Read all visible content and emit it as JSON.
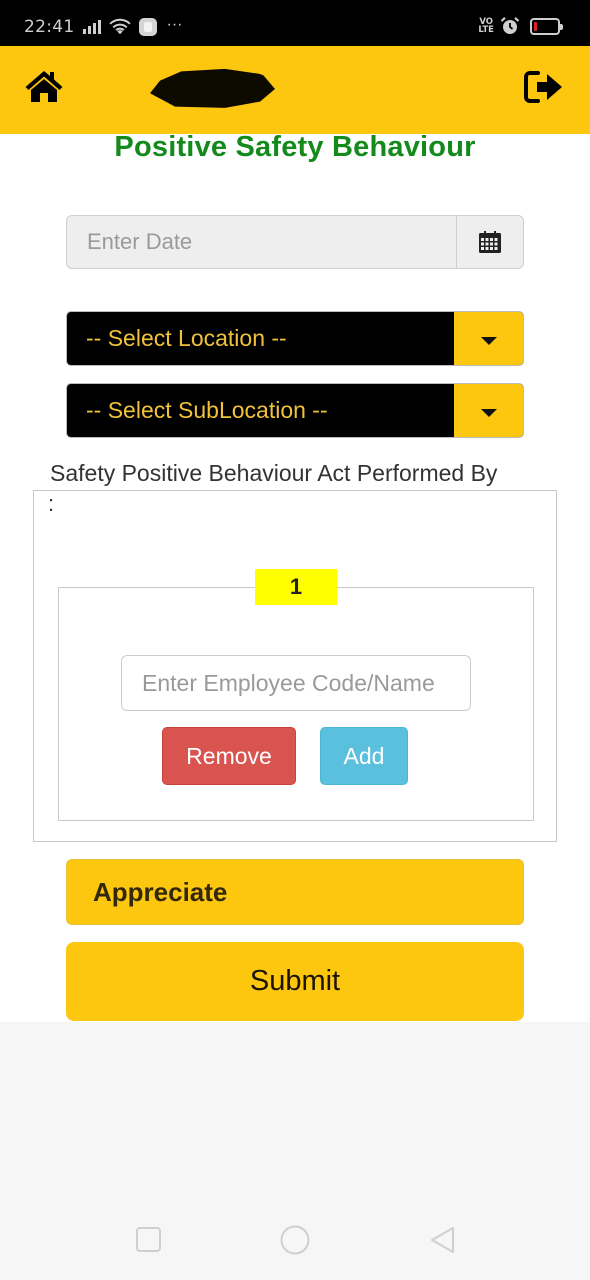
{
  "status_bar": {
    "time": "22:41",
    "overflow": "···",
    "network_label": "VO LTE",
    "battery_level": 0.12,
    "icons": [
      "signal-icon",
      "wifi-icon",
      "app-notification-icon",
      "volte-icon",
      "alarm-icon",
      "battery-icon"
    ]
  },
  "header": {
    "home_icon": "home-icon",
    "logout_icon": "sign-out-icon",
    "logo": "redacted-logo"
  },
  "page": {
    "title": "Positive Safety Behaviour"
  },
  "form": {
    "date": {
      "placeholder": "Enter Date",
      "value": "",
      "icon": "calendar-icon"
    },
    "location": {
      "selected": "-- Select Location --"
    },
    "sublocation": {
      "selected": "-- Select SubLocation --"
    },
    "performed_by": {
      "legend": "Safety Positive Behaviour Act Performed By",
      "colon": ":",
      "entries": [
        {
          "number": "1",
          "employee_placeholder": "Enter Employee Code/Name",
          "employee_value": "",
          "remove_label": "Remove",
          "add_label": "Add"
        }
      ]
    },
    "appreciate_label": "Appreciate",
    "submit_label": "Submit"
  },
  "colors": {
    "brand_yellow": "#fec70f",
    "title_green": "#138a1b",
    "select_text": "#f0c23a",
    "badge_yellow": "#ffff00",
    "danger": "#d9534f",
    "info": "#5bc0de"
  },
  "nav_bar": {
    "buttons": [
      "recents",
      "home",
      "back"
    ]
  }
}
